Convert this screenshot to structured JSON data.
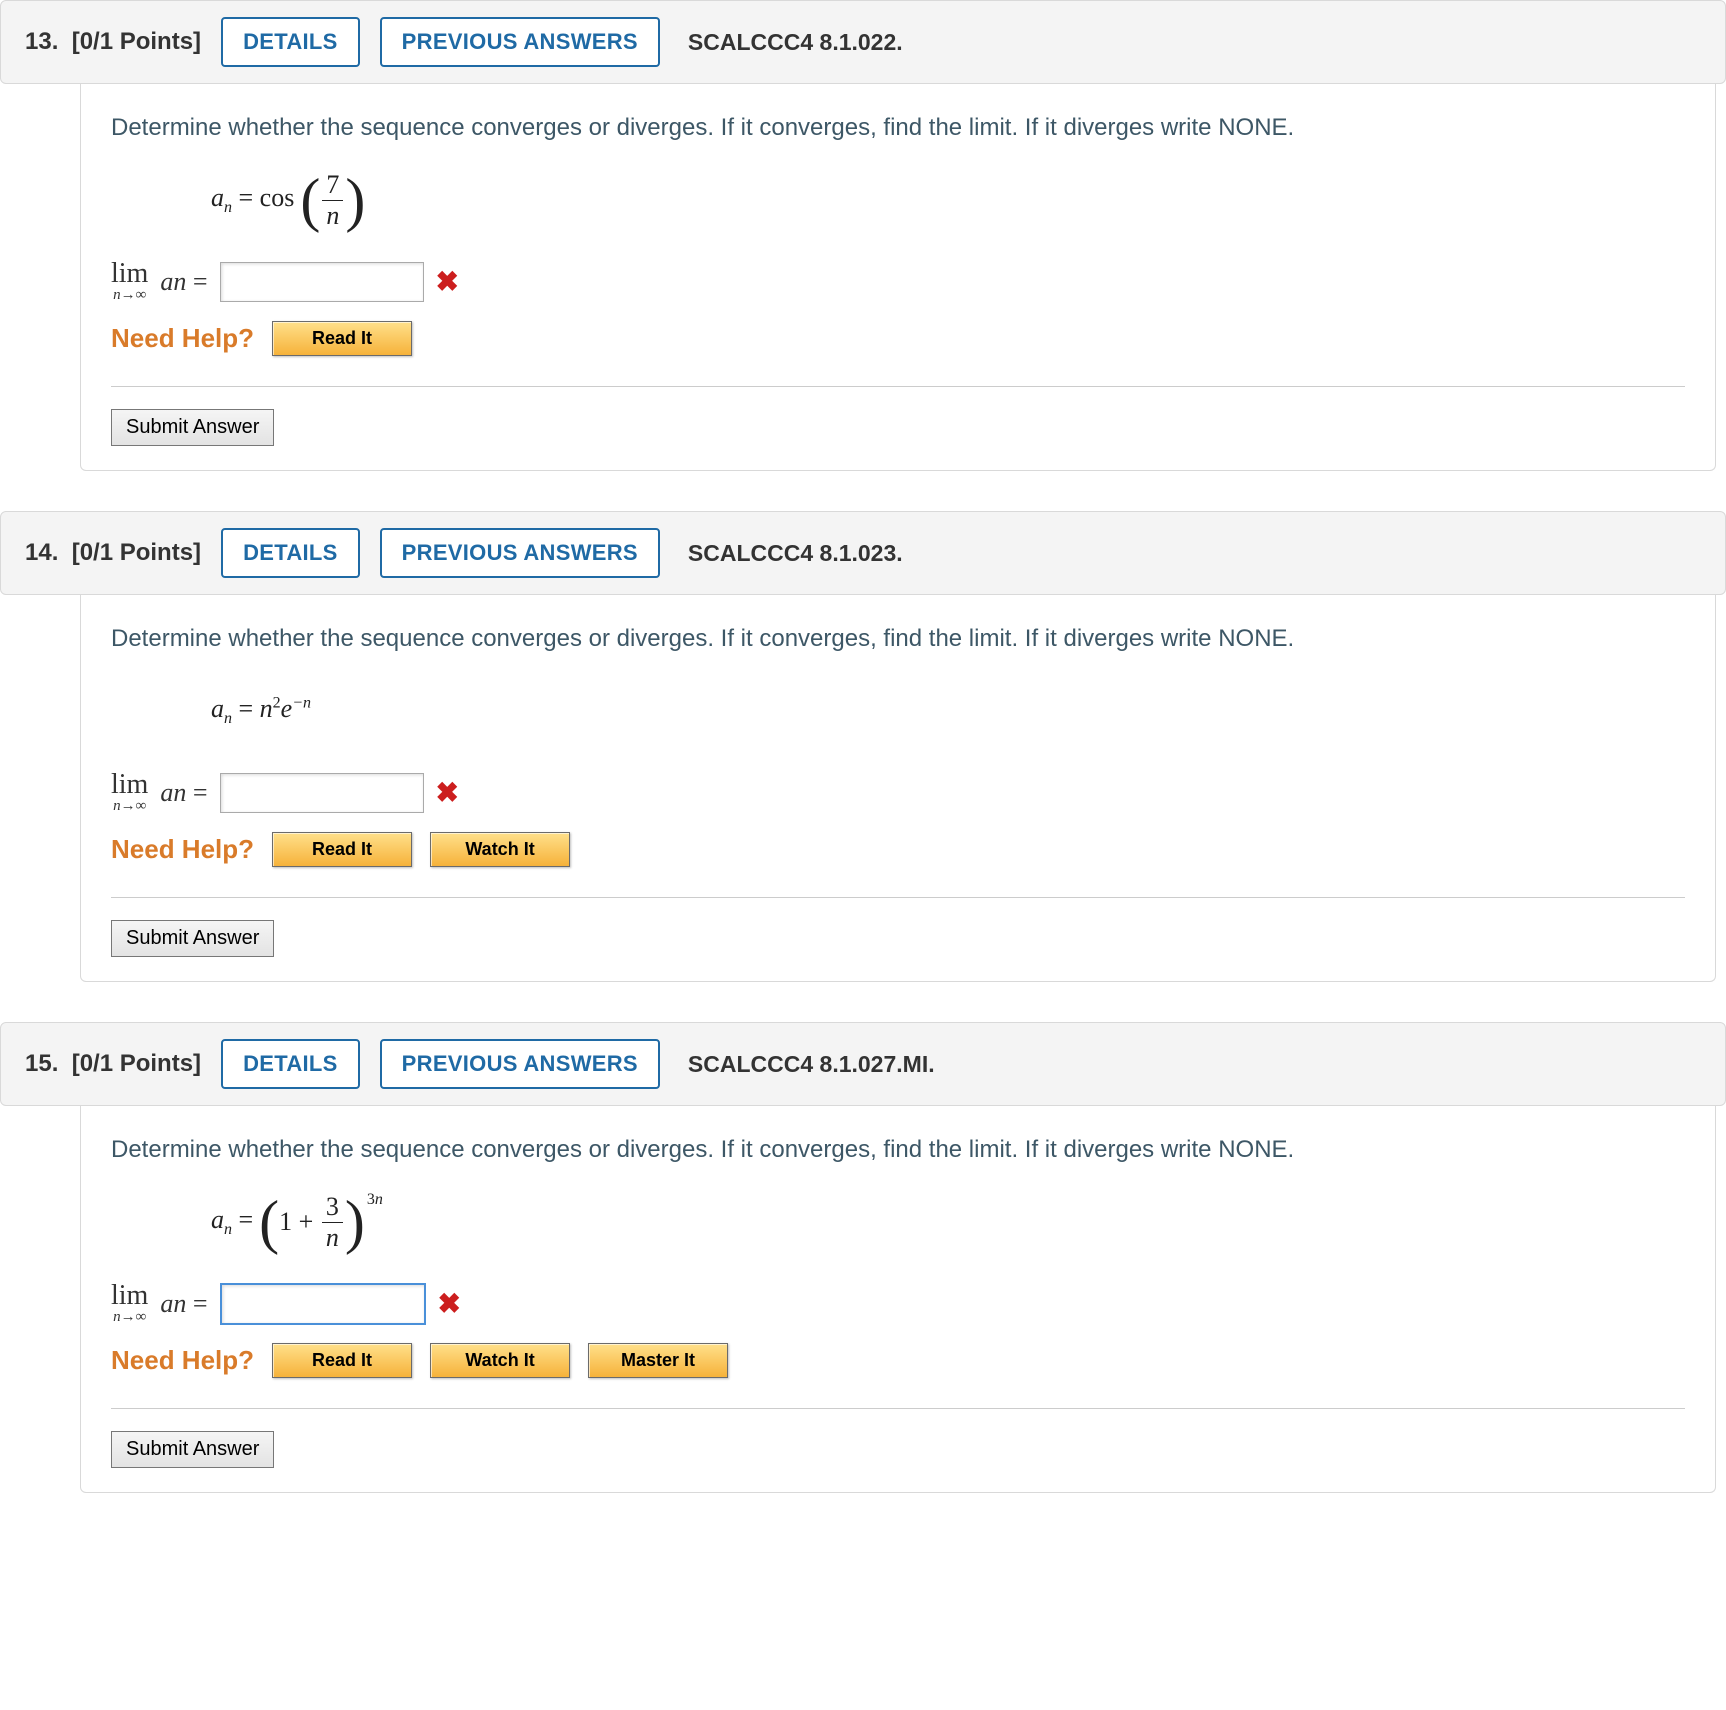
{
  "buttons": {
    "details": "DETAILS",
    "previous": "PREVIOUS ANSWERS",
    "readit": "Read It",
    "watchit": "Watch It",
    "masterit": "Master It",
    "submit": "Submit Answer"
  },
  "labels": {
    "needhelp": "Need Help?"
  },
  "questions": [
    {
      "number": "13.",
      "points": "[0/1 Points]",
      "reference": "SCALCCC4 8.1.022.",
      "prompt": "Determine whether the sequence converges or diverges. If it converges, find the limit. If it diverges write NONE.",
      "formula_type": "cos",
      "answer": "",
      "selected": false,
      "help": [
        "readit"
      ]
    },
    {
      "number": "14.",
      "points": "[0/1 Points]",
      "reference": "SCALCCC4 8.1.023.",
      "prompt": "Determine whether the sequence converges or diverges. If it converges, find the limit. If it diverges write NONE.",
      "formula_type": "n2e",
      "answer": "",
      "selected": false,
      "help": [
        "readit",
        "watchit"
      ]
    },
    {
      "number": "15.",
      "points": "[0/1 Points]",
      "reference": "SCALCCC4 8.1.027.MI.",
      "prompt": "Determine whether the sequence converges or diverges. If it converges, find the limit. If it diverges write NONE.",
      "formula_type": "oneplus",
      "answer": "",
      "selected": true,
      "help": [
        "readit",
        "watchit",
        "masterit"
      ]
    }
  ]
}
